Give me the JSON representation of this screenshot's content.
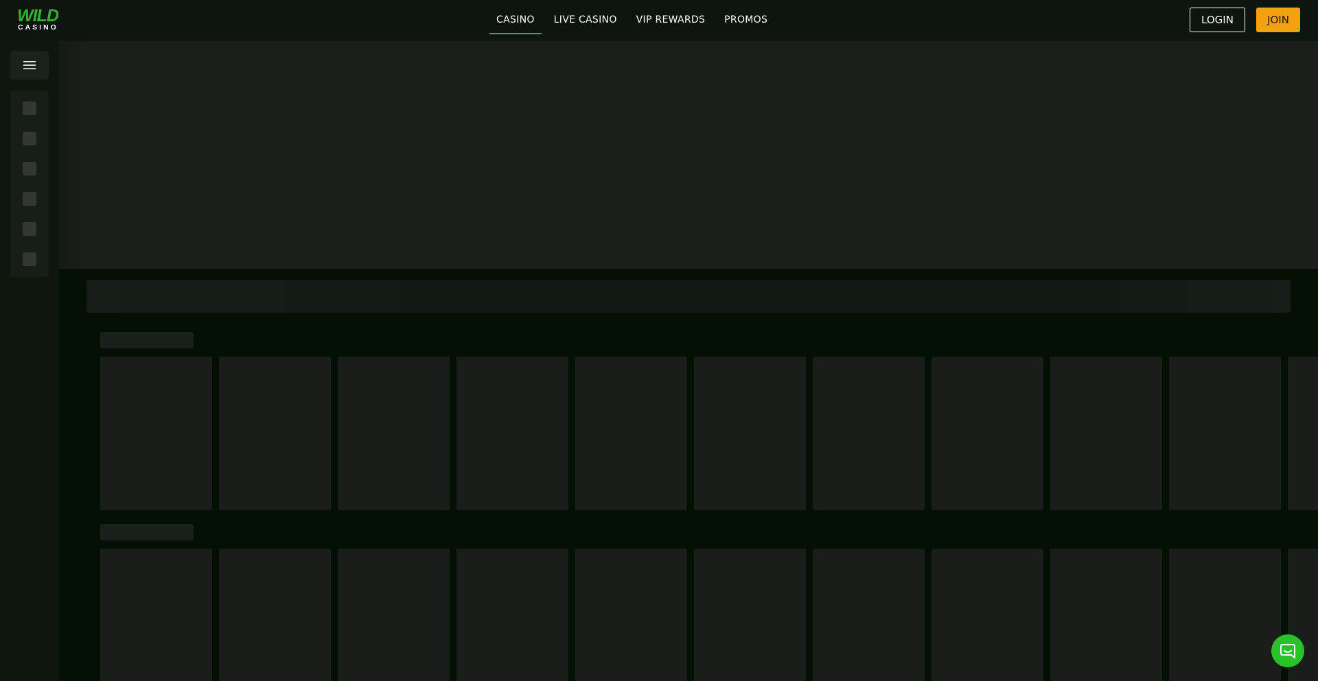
{
  "header": {
    "logo": {
      "word": "WILD",
      "subword": "CASINO"
    },
    "nav": [
      {
        "label": "CASINO",
        "active": true
      },
      {
        "label": "LIVE CASINO",
        "active": false
      },
      {
        "label": "VIP REWARDS",
        "active": false
      },
      {
        "label": "PROMOS",
        "active": false
      }
    ],
    "login_label": "LOGIN",
    "join_label": "JOIN"
  },
  "sidebar": {
    "menu_icon": "hamburger-menu-icon",
    "placeholder_slots": 6
  },
  "colors": {
    "accent_green": "#2fb52f",
    "join_orange": "#f3a10c",
    "background": "#051005",
    "header_bg": "#0e140e",
    "skeleton": "#1a1e1a"
  },
  "icons": {
    "chat": "chat-bubble-icon",
    "menu": "hamburger-menu-icon"
  }
}
